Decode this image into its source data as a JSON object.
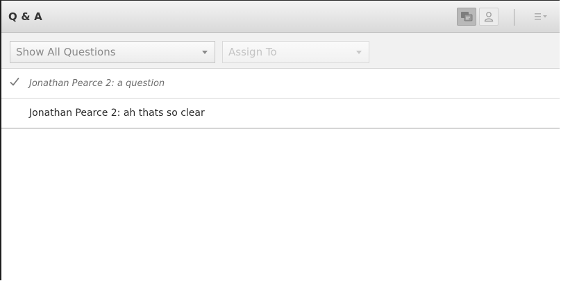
{
  "header": {
    "title": "Q & A",
    "view_icons": [
      "question-view-icon",
      "presenter-view-icon"
    ],
    "menu_icon": "menu-list-icon"
  },
  "filters": {
    "show_questions": {
      "value": "Show All Questions",
      "icon": "chevron-down-icon"
    },
    "assign_to": {
      "value": "Assign To",
      "disabled": true,
      "icon": "chevron-down-icon"
    }
  },
  "questions": [
    {
      "text": "Jonathan Pearce 2: a question",
      "answered": true,
      "icon": "check-icon"
    },
    {
      "text": "Jonathan Pearce 2: ah thats so clear",
      "answered": false
    }
  ],
  "colors": {
    "titlebar_top": "#f4f4f4",
    "titlebar_bottom": "#d9d9d9",
    "filterbar_bg": "#f1f1f1",
    "border_dark": "#1e1e1e",
    "row_divider": "#d7d7d7"
  }
}
